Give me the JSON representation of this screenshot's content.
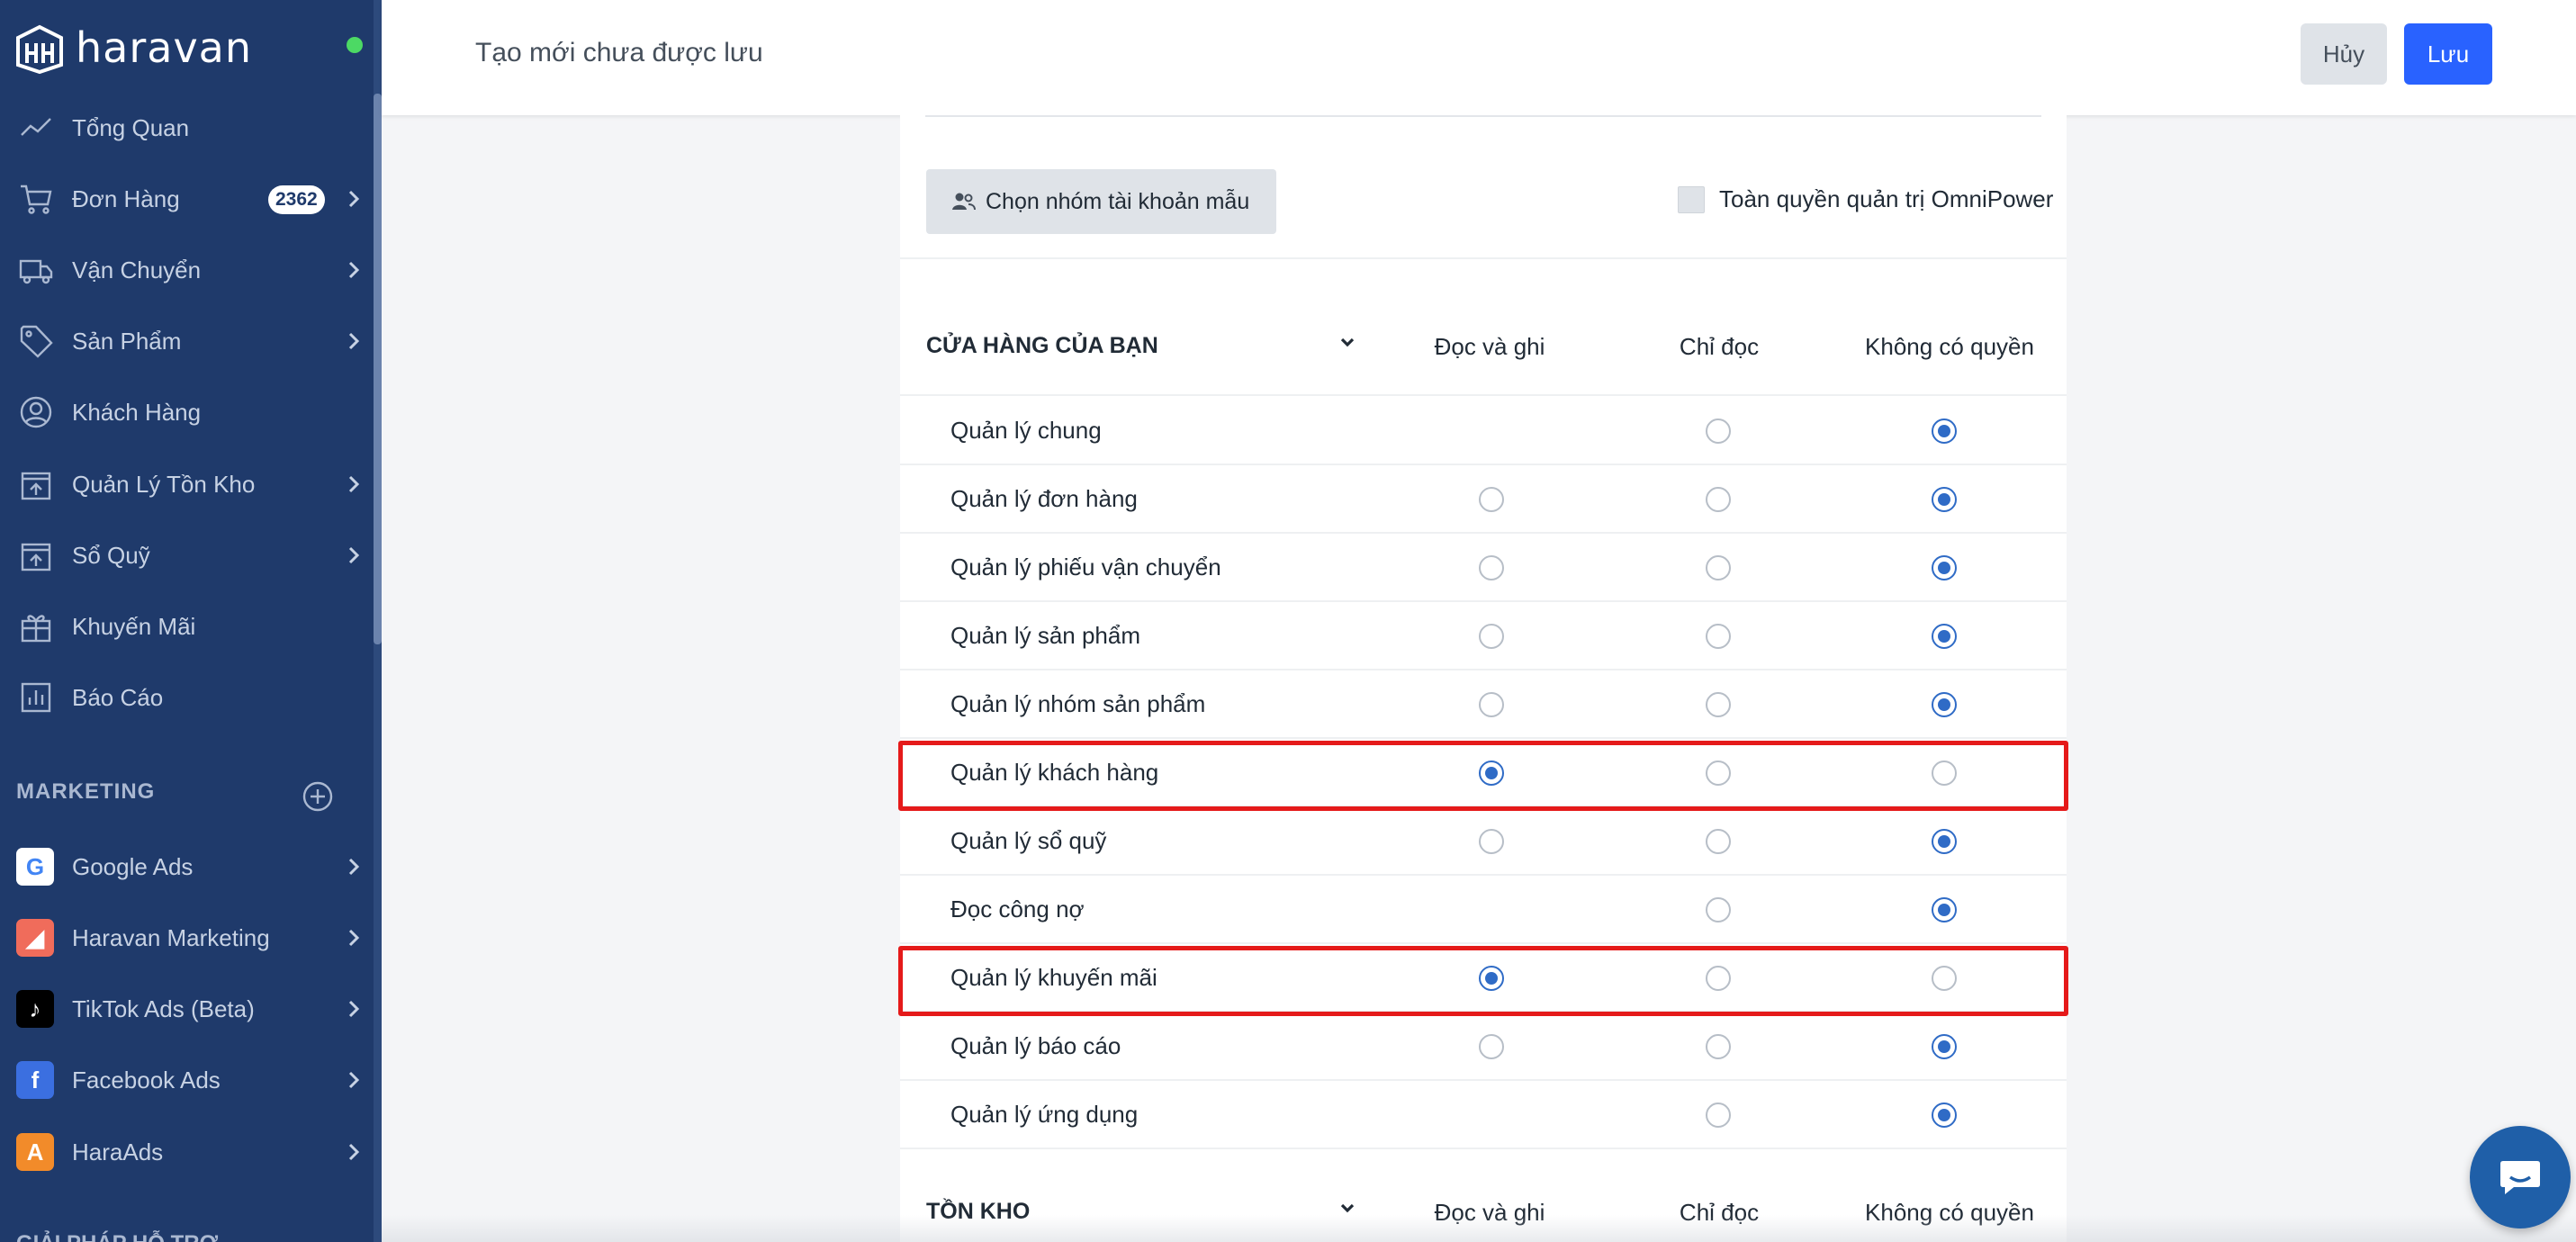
{
  "brand": {
    "name": "haravan",
    "status_color": "#4cd964"
  },
  "sidebar": {
    "items": [
      {
        "label": "Tổng Quan",
        "icon": "trend-line-icon"
      },
      {
        "label": "Đơn Hàng",
        "icon": "cart-icon",
        "badge": "2362"
      },
      {
        "label": "Vận Chuyển",
        "icon": "truck-icon"
      },
      {
        "label": "Sản Phẩm",
        "icon": "tag-icon"
      },
      {
        "label": "Khách Hàng",
        "icon": "user-circle-icon"
      },
      {
        "label": "Quản Lý Tồn Kho",
        "icon": "box-upload-icon"
      },
      {
        "label": "Sổ Quỹ",
        "icon": "box-upload-icon"
      },
      {
        "label": "Khuyến Mãi",
        "icon": "gift-icon"
      },
      {
        "label": "Báo Cáo",
        "icon": "bar-chart-icon"
      }
    ],
    "marketing_title": "MARKETING",
    "apps": [
      {
        "label": "Google Ads",
        "icon": "google-icon",
        "color": "#ffffff"
      },
      {
        "label": "Haravan Marketing",
        "icon": "haravan-marketing-icon",
        "color": "#f06c5b"
      },
      {
        "label": "TikTok Ads (Beta)",
        "icon": "tiktok-icon",
        "color": "#000000"
      },
      {
        "label": "Facebook Ads",
        "icon": "facebook-icon",
        "color": "#3b6fe0"
      },
      {
        "label": "HaraAds",
        "icon": "haraads-icon",
        "color": "#f28b2a"
      }
    ],
    "bottom_section": "GIẢI PHÁP HỖ TRỢ"
  },
  "header": {
    "title": "Tạo mới chưa được lưu",
    "cancel_label": "Hủy",
    "save_label": "Lưu",
    "accent_color": "#2962ff"
  },
  "form": {
    "template_button": "Chọn nhóm tài khoản mẫu",
    "full_admin_label": "Toàn quyền quản trị OmniPower",
    "full_admin_checked": false
  },
  "permissions": {
    "columns": [
      "Đọc và ghi",
      "Chỉ đọc",
      "Không có quyền"
    ],
    "sections": [
      {
        "title": "CỬA HÀNG CỦA BẠN",
        "rows": [
          {
            "label": "Quản lý chung",
            "options": [
              false,
              true,
              true
            ],
            "selected": 2,
            "highlighted": false
          },
          {
            "label": "Quản lý đơn hàng",
            "options": [
              true,
              true,
              true
            ],
            "selected": 2,
            "highlighted": false
          },
          {
            "label": "Quản lý phiếu vận chuyển",
            "options": [
              true,
              true,
              true
            ],
            "selected": 2,
            "highlighted": false
          },
          {
            "label": "Quản lý sản phẩm",
            "options": [
              true,
              true,
              true
            ],
            "selected": 2,
            "highlighted": false
          },
          {
            "label": "Quản lý nhóm sản phẩm",
            "options": [
              true,
              true,
              true
            ],
            "selected": 2,
            "highlighted": false
          },
          {
            "label": "Quản lý khách hàng",
            "options": [
              true,
              true,
              true
            ],
            "selected": 0,
            "highlighted": true
          },
          {
            "label": "Quản lý sổ quỹ",
            "options": [
              true,
              true,
              true
            ],
            "selected": 2,
            "highlighted": false
          },
          {
            "label": "Đọc công nợ",
            "options": [
              false,
              true,
              true
            ],
            "selected": 2,
            "highlighted": false
          },
          {
            "label": "Quản lý khuyến mãi",
            "options": [
              true,
              true,
              true
            ],
            "selected": 0,
            "highlighted": true
          },
          {
            "label": "Quản lý báo cáo",
            "options": [
              true,
              true,
              true
            ],
            "selected": 2,
            "highlighted": false
          },
          {
            "label": "Quản lý ứng dụng",
            "options": [
              false,
              true,
              true
            ],
            "selected": 2,
            "highlighted": false
          }
        ]
      },
      {
        "title": "TỒN KHO",
        "rows": []
      }
    ],
    "highlight_color": "#e51a1a",
    "radio_color": "#2f6bc6"
  }
}
